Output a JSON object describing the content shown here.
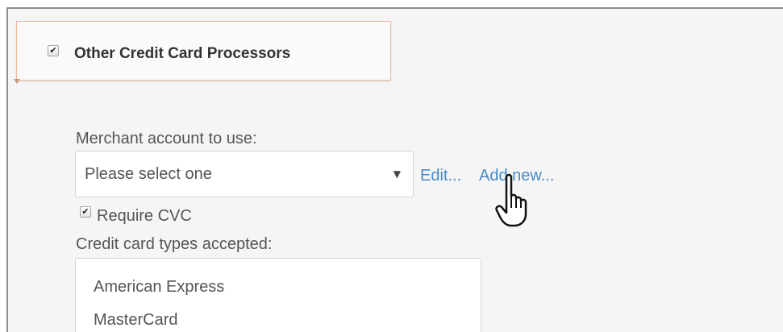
{
  "section": {
    "title": "Other Credit Card Processors",
    "enabled": true
  },
  "merchant": {
    "label": "Merchant account to use:",
    "selected": "Please select one",
    "edit_link": "Edit...",
    "add_new_link": "Add new..."
  },
  "cvc": {
    "label": "Require CVC",
    "checked": true
  },
  "card_types": {
    "label": "Credit card types accepted:",
    "items": [
      "American Express",
      "MasterCard"
    ]
  },
  "icons": {
    "dropdown": "chevron-down-icon",
    "cursor": "hand-pointer-icon"
  },
  "colors": {
    "link": "#4a8ac8",
    "tab_border": "#f1b89a",
    "text": "#555555"
  }
}
